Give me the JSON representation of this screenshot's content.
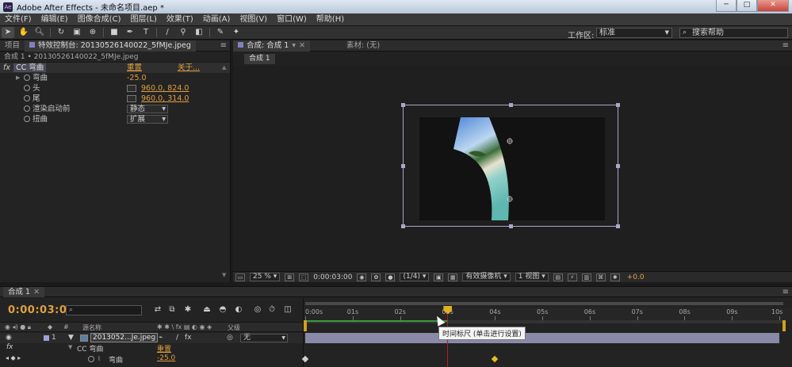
{
  "window": {
    "title": "Adobe After Effects - 未命名项目.aep *",
    "app_icon": "Ae"
  },
  "menu": [
    "文件(F)",
    "编辑(E)",
    "图像合成(C)",
    "图层(L)",
    "效果(T)",
    "动画(A)",
    "视图(V)",
    "窗口(W)",
    "帮助(H)"
  ],
  "toolbar": {
    "workspace_label": "工作区:",
    "workspace_value": "标准",
    "search_placeholder": "搜索帮助"
  },
  "left_panel": {
    "tabs": [
      {
        "label": "项目"
      },
      {
        "label": "特效控制台: 20130526140022_5fMJe.jpeg"
      }
    ],
    "comp_path": "合成 1 • 20130526140022_5fMJe.jpeg",
    "effect": {
      "fx_badge": "fx",
      "name": "CC 弯曲",
      "reset": "重置",
      "about": "关于...",
      "properties": [
        {
          "label": "弯曲",
          "value": "-25.0"
        },
        {
          "label": "头",
          "value": "960.0, 824.0"
        },
        {
          "label": "尾",
          "value": "960.0, 314.0"
        },
        {
          "label": "渲染启动前",
          "value": "静态"
        },
        {
          "label": "扭曲",
          "value": "扩展"
        }
      ]
    }
  },
  "comp_panel": {
    "tabs": [
      {
        "label": "合成: 合成 1"
      },
      {
        "label": "素材: (无)"
      }
    ],
    "subtab": "合成 1",
    "footer": {
      "zoom": "25 %",
      "timecode": "0:00:03:00",
      "resolution": "(1/4)",
      "camera": "有效摄像机",
      "views": "1 视图",
      "exposure": "+0.0"
    }
  },
  "timeline": {
    "tab": "合成 1",
    "timecode": "0:00:03:00",
    "columns": {
      "source_name": "源名称",
      "parent": "父级"
    },
    "layer": {
      "index": "1",
      "name": "2013052...Je.jpeg",
      "parent": "无"
    },
    "effect_row": {
      "fx": "fx",
      "name": "CC 弯曲",
      "reset": "重置"
    },
    "prop_row": {
      "name": "弯曲",
      "value": "-25.0"
    },
    "ruler_labels": [
      "0:00s",
      "01s",
      "02s",
      "03s",
      "04s",
      "05s",
      "06s",
      "07s",
      "08s",
      "09s",
      "10s"
    ],
    "tooltip": "时间标尺 (单击进行设置)",
    "current_time_seconds": 3,
    "duration_seconds": 10,
    "keyframes_seconds": [
      0,
      4
    ],
    "colors": {
      "timecode": "#e0a040",
      "layer_bar": "#8a8aa8",
      "ctix": "#b02020",
      "keyframe": "#e0c020"
    }
  }
}
